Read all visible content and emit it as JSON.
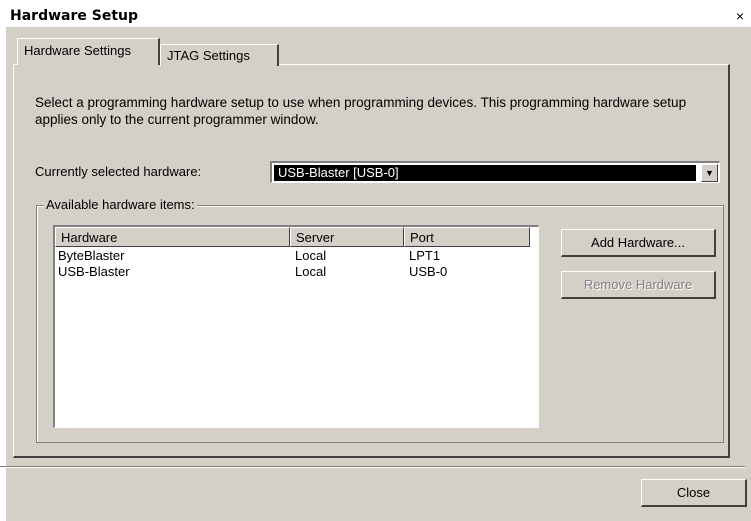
{
  "window": {
    "title": "Hardware Setup",
    "close_glyph": "×"
  },
  "tabs": [
    {
      "label": "Hardware Settings",
      "active": true
    },
    {
      "label": "JTAG Settings",
      "active": false
    }
  ],
  "description": "Select a programming hardware setup to use when programming devices. This programming hardware setup applies only to the current programmer window.",
  "current_hardware": {
    "label": "Currently selected hardware:",
    "value": "USB-Blaster [USB-0]",
    "dropdown_icon": "chevron-down-icon"
  },
  "available": {
    "group_label": "Available hardware items:",
    "columns": [
      "Hardware",
      "Server",
      "Port"
    ],
    "rows": [
      {
        "hardware": "ByteBlaster",
        "server": "Local",
        "port": "LPT1"
      },
      {
        "hardware": "USB-Blaster",
        "server": "Local",
        "port": "USB-0"
      }
    ]
  },
  "buttons": {
    "add": "Add Hardware...",
    "remove": "Remove Hardware",
    "close": "Close"
  }
}
